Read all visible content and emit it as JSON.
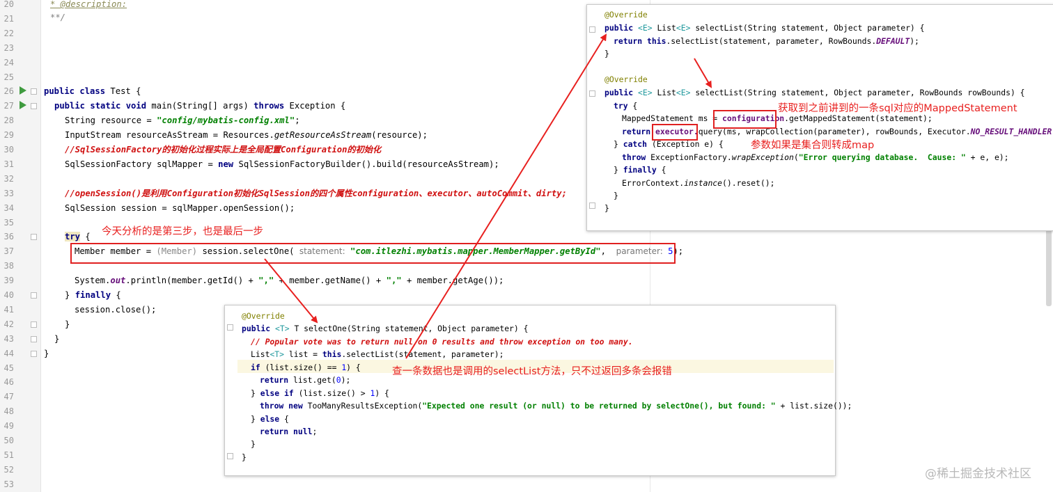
{
  "editor": {
    "line_numbers": [
      "20",
      "21",
      "22",
      "23",
      "24",
      "25",
      "26",
      "27",
      "28",
      "29",
      "30",
      "31",
      "32",
      "33",
      "34",
      "35",
      "36",
      "37",
      "38",
      "39",
      "40",
      "41",
      "42",
      "43",
      "44",
      "45",
      "46",
      "47",
      "48",
      "49",
      "50",
      "51",
      "52",
      "53"
    ],
    "lines": {
      "l20_comment": "* @description:",
      "l21_comment": "**/",
      "l26_public": "public class",
      "l26_name": " Test {",
      "l27_mods": "public static void",
      "l27_sig": " main(String[] args) ",
      "l27_throws": "throws",
      "l27_tail": " Exception {",
      "l28_a": "String resource = ",
      "l28_str": "\"config/mybatis-config.xml\"",
      "l28_b": ";",
      "l29_a": "InputStream resourceAsStream = Resources.",
      "l29_it": "getResourceAsStream",
      "l29_b": "(resource);",
      "l30_comment": "//SqlSessionFactory的初始化过程实际上是全局配置Configuration的初始化",
      "l31_a": "SqlSessionFactory sqlMapper = ",
      "l31_new": "new",
      "l31_b": " SqlSessionFactoryBuilder().build(resourceAsStream);",
      "l33_comment": "//openSession()是利用Configuration初始化SqlSession的四个属性configuration、executor、autoCommit、dirty;",
      "l34": "SqlSession session = sqlMapper.openSession();",
      "l36_try": "try",
      "l36_brace": " {",
      "l37_a": "Member member = ",
      "l37_cast": "(Member)",
      "l37_b": " session.selectOne( ",
      "l37_hint1": "statement:",
      "l37_str": " \"com.itlezhi.mybatis.mapper.MemberMapper.getById\"",
      "l37_c": ",  ",
      "l37_hint2": "parameter:",
      "l37_num": " 5",
      "l37_d": ");",
      "l39_a": "System.",
      "l39_out": "out",
      "l39_b": ".println(member.getId() + ",
      "l39_s1": "\",\"",
      "l39_c": " + member.getName() + ",
      "l39_s2": "\",\"",
      "l39_d": " + member.getAge());",
      "l40_a": "} ",
      "l40_finally": "finally",
      "l40_b": " {",
      "l41": "session.close();",
      "l42": "}",
      "l43": "}",
      "l44": "}"
    }
  },
  "popup_top": {
    "p1": "@Override",
    "p2_public": "public",
    "p2_gen1": " <E>",
    "p2_a": " List",
    "p2_gen2": "<E>",
    "p2_b": " selectList(String statement, Object parameter) {",
    "p3_return": "return this",
    "p3_a": ".selectList(statement, parameter, RowBounds.",
    "p3_field": "DEFAULT",
    "p3_b": ");",
    "p4": "}",
    "p5": "@Override",
    "p6_public": "public",
    "p6_gen1": " <E>",
    "p6_a": " List",
    "p6_gen2": "<E>",
    "p6_b": " selectList(String statement, Object parameter, RowBounds rowBounds) {",
    "p7_try": "try",
    "p7_b": " {",
    "p8_a": "MappedStatement ms = ",
    "p8_conf": "configuration",
    "p8_b": ".getMappedStatement(statement);",
    "p9_return": "return",
    "p9_exec": "executor.",
    "p9_b": "query(ms, wrapCollection(parameter), rowBounds, Executor.",
    "p9_field": "NO_RESULT_HANDLER",
    "p9_c": ");",
    "p10_a": "} ",
    "p10_catch": "catch",
    "p10_b": " (Exception e) {",
    "p11_throw": "throw",
    "p11_a": " ExceptionFactory.",
    "p11_it": "wrapException",
    "p11_b": "(",
    "p11_str": "\"Error querying database.  Cause: \"",
    "p11_c": " + e, e);",
    "p12_a": "} ",
    "p12_finally": "finally",
    "p12_b": " {",
    "p13_a": "ErrorContext.",
    "p13_it": "instance",
    "p13_b": "().reset();",
    "p14": "}",
    "p15": "}"
  },
  "popup_bottom": {
    "b1": "@Override",
    "b2_public": "public",
    "b2_gen": " <T>",
    "b2_b": " T selectOne(String statement, Object parameter) {",
    "b3_comment": "// Popular vote was to return null on 0 results and throw exception on too many.",
    "b4_a": "List",
    "b4_gen": "<T>",
    "b4_b": " list = ",
    "b4_this": "this",
    "b4_c": ".selectList(statement, parameter);",
    "b5_if": "if",
    "b5_b": " (list.size() == ",
    "b5_num": "1",
    "b5_c": ") {",
    "b6_return": "return",
    "b6_b": " list.get(",
    "b6_num": "0",
    "b6_c": ");",
    "b7_a": "} ",
    "b7_else": "else if",
    "b7_b": " (list.size() > ",
    "b7_num": "1",
    "b7_c": ") {",
    "b8_throw": "throw new",
    "b8_a": " TooManyResultsException(",
    "b8_str": "\"Expected one result (or null) to be returned by selectOne(), but found: \"",
    "b8_b": " + list.size());",
    "b9_a": "} ",
    "b9_else": "else",
    "b9_b": " {",
    "b10_return": "return null",
    "b10_b": ";",
    "b11": "}",
    "b12": "}"
  },
  "annotations": {
    "step_note": "今天分析的是第三步，也是最后一步",
    "mapped_note": "获取到之前讲到的一条sql对应的MappedStatement",
    "collection_note": "参数如果是集合则转成map",
    "selectone_note": "查一条数据也是调用的selectList方法，只不过返回多条会报错"
  },
  "watermark": "@稀土掘金技术社区",
  "colors": {
    "annotation_red": "#e8201f",
    "keyword": "#000080",
    "string": "#008000"
  }
}
